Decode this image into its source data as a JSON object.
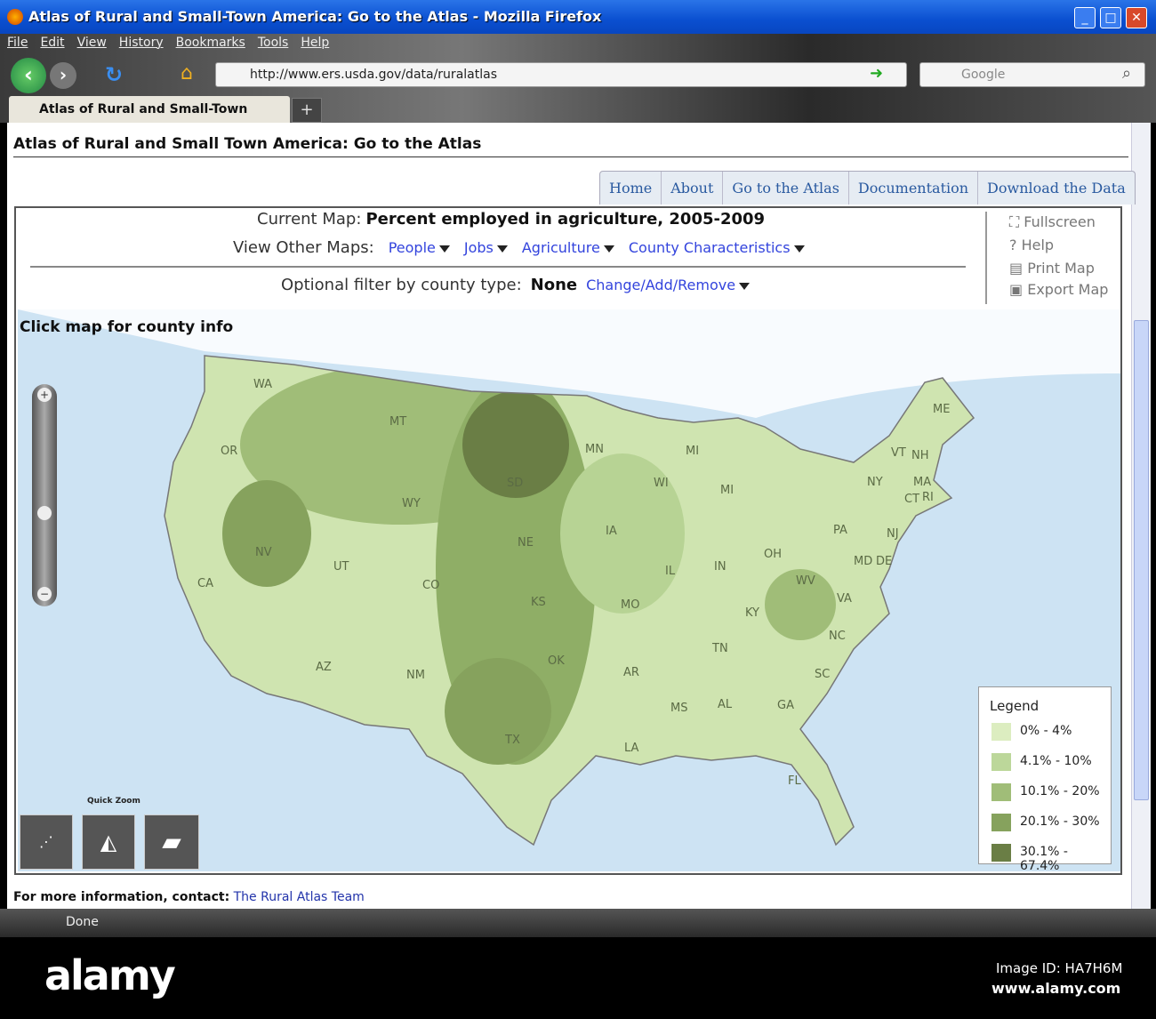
{
  "window": {
    "title": "Atlas of Rural and Small-Town America: Go to the Atlas - Mozilla Firefox"
  },
  "menu": [
    "File",
    "Edit",
    "View",
    "History",
    "Bookmarks",
    "Tools",
    "Help"
  ],
  "url": "http://www.ers.usda.gov/data/ruralatlas",
  "search_placeholder": "Google",
  "tab": {
    "label": "Atlas of Rural and Small-Town Ameri...",
    "new": "+"
  },
  "page": {
    "title": "Atlas of Rural and Small Town America: Go to the Atlas",
    "nav": [
      "Home",
      "About",
      "Go to the Atlas",
      "Documentation",
      "Download the Data"
    ],
    "current_map_label": "Current Map:",
    "current_map": "Percent employed in agriculture, 2005-2009",
    "other_maps_label": "View Other Maps:",
    "other_maps": [
      "People",
      "Jobs",
      "Agriculture",
      "County Characteristics"
    ],
    "filter_label": "Optional filter by county type:",
    "filter_value": "None",
    "filter_link": "Change/Add/Remove",
    "tools": [
      "Fullscreen",
      "Help",
      "Print Map",
      "Export Map"
    ],
    "map_hint": "Click map for county info",
    "quick_zoom": "Quick Zoom",
    "states": [
      [
        "WA",
        295,
        433
      ],
      [
        "OR",
        258,
        508
      ],
      [
        "CA",
        232,
        657
      ],
      [
        "NV",
        297,
        622
      ],
      [
        "MT",
        448,
        475
      ],
      [
        "WY",
        462,
        567
      ],
      [
        "UT",
        385,
        638
      ],
      [
        "AZ",
        365,
        751
      ],
      [
        "CO",
        485,
        659
      ],
      [
        "NM",
        467,
        760
      ],
      [
        "SD",
        580,
        544
      ],
      [
        "NE",
        592,
        611
      ],
      [
        "KS",
        607,
        678
      ],
      [
        "OK",
        626,
        744
      ],
      [
        "TX",
        578,
        833
      ],
      [
        "MN",
        668,
        506
      ],
      [
        "IA",
        691,
        598
      ],
      [
        "MO",
        708,
        681
      ],
      [
        "AR",
        711,
        757
      ],
      [
        "LA",
        712,
        842
      ],
      [
        "WI",
        745,
        544
      ],
      [
        "IL",
        758,
        643
      ],
      [
        "MI",
        781,
        508
      ],
      [
        "MI",
        820,
        552
      ],
      [
        "IN",
        813,
        638
      ],
      [
        "OH",
        869,
        624
      ],
      [
        "KY",
        848,
        690
      ],
      [
        "TN",
        811,
        730
      ],
      [
        "MS",
        764,
        797
      ],
      [
        "AL",
        817,
        793
      ],
      [
        "GA",
        884,
        794
      ],
      [
        "FL",
        896,
        879
      ],
      [
        "SC",
        926,
        759
      ],
      [
        "NC",
        942,
        716
      ],
      [
        "VA",
        951,
        674
      ],
      [
        "WV",
        905,
        654
      ],
      [
        "PA",
        947,
        597
      ],
      [
        "NY",
        985,
        543
      ],
      [
        "VT",
        1012,
        510
      ],
      [
        "NH",
        1035,
        513
      ],
      [
        "ME",
        1059,
        461
      ],
      [
        "MA",
        1037,
        543
      ],
      [
        "CT",
        1027,
        562
      ],
      [
        "RI",
        1047,
        560
      ],
      [
        "NJ",
        1007,
        601
      ],
      [
        "MD",
        970,
        632
      ],
      [
        "DE",
        995,
        632
      ]
    ],
    "legend": {
      "title": "Legend",
      "items": [
        {
          "label": "0% - 4%",
          "color": "#dcedc0"
        },
        {
          "label": "4.1% - 10%",
          "color": "#bcd79a"
        },
        {
          "label": "10.1% - 20%",
          "color": "#a0bd78"
        },
        {
          "label": "20.1% - 30%",
          "color": "#86a25d"
        },
        {
          "label": "30.1% - 67.4%",
          "color": "#6a7e45"
        }
      ]
    },
    "footer_label": "For more information, contact:",
    "footer_link": "The Rural Atlas Team"
  },
  "status": "Done",
  "watermark": {
    "brand": "alamy",
    "image_id": "Image ID: HA7H6M",
    "site": "www.alamy.com"
  }
}
